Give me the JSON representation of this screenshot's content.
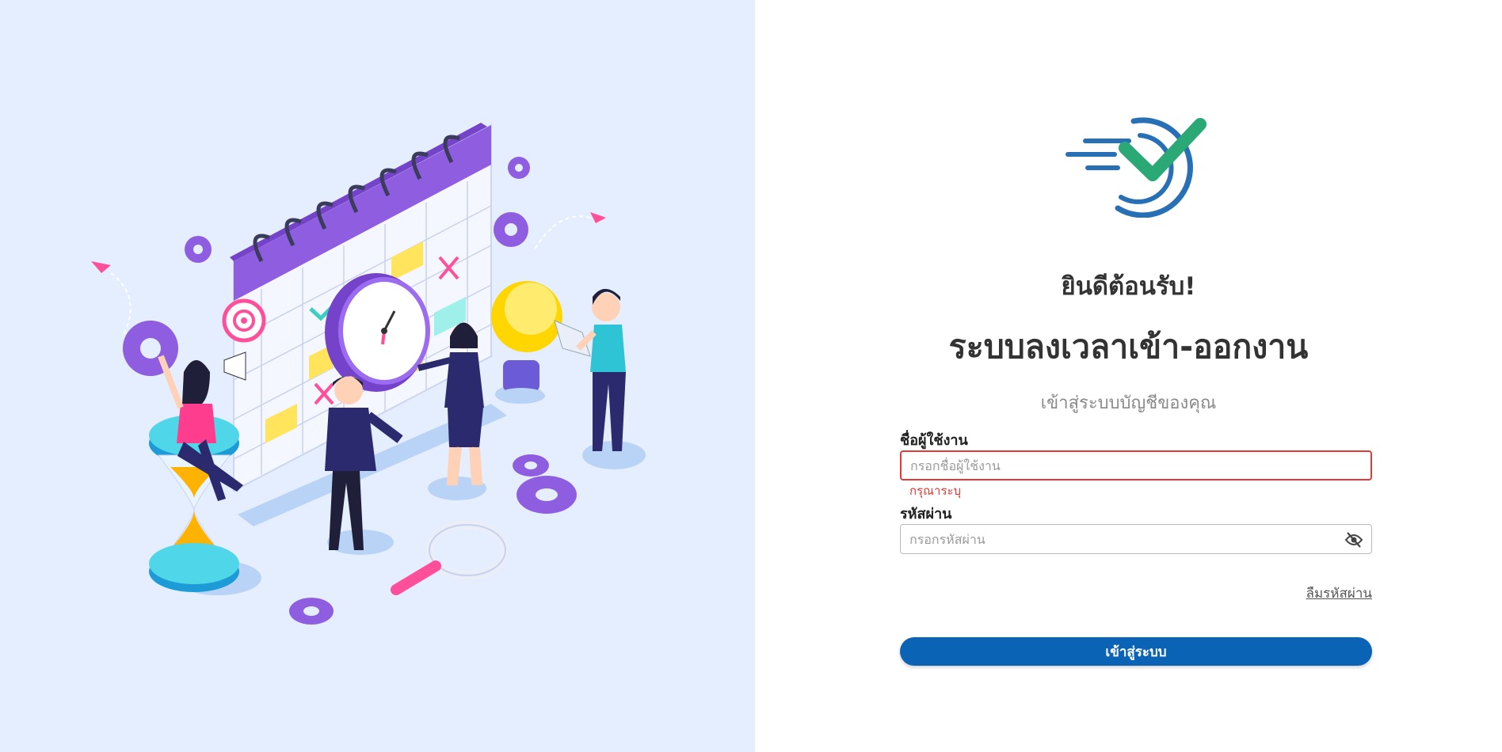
{
  "welcome": "ยินดีต้อนรับ!",
  "title": "ระบบลงเวลาเข้า-ออกงาน",
  "subtitle": "เข้าสู่ระบบบัญชีของคุณ",
  "username": {
    "label": "ชื่อผู้ใช้งาน",
    "placeholder": "กรอกชื่อผู้ใช้งาน",
    "value": "",
    "error": "กรุณาระบุ"
  },
  "password": {
    "label": "รหัสผ่าน",
    "placeholder": "กรอกรหัสผ่าน",
    "value": ""
  },
  "forgot_password": "ลืมรหัสผ่าน",
  "login_button": "เข้าสู่ระบบ",
  "colors": {
    "brand_blue": "#0b63b5",
    "logo_blue": "#2870b6",
    "logo_green": "#2aa876",
    "error_red": "#e53935",
    "illustration_bg": "#e4eeff"
  }
}
